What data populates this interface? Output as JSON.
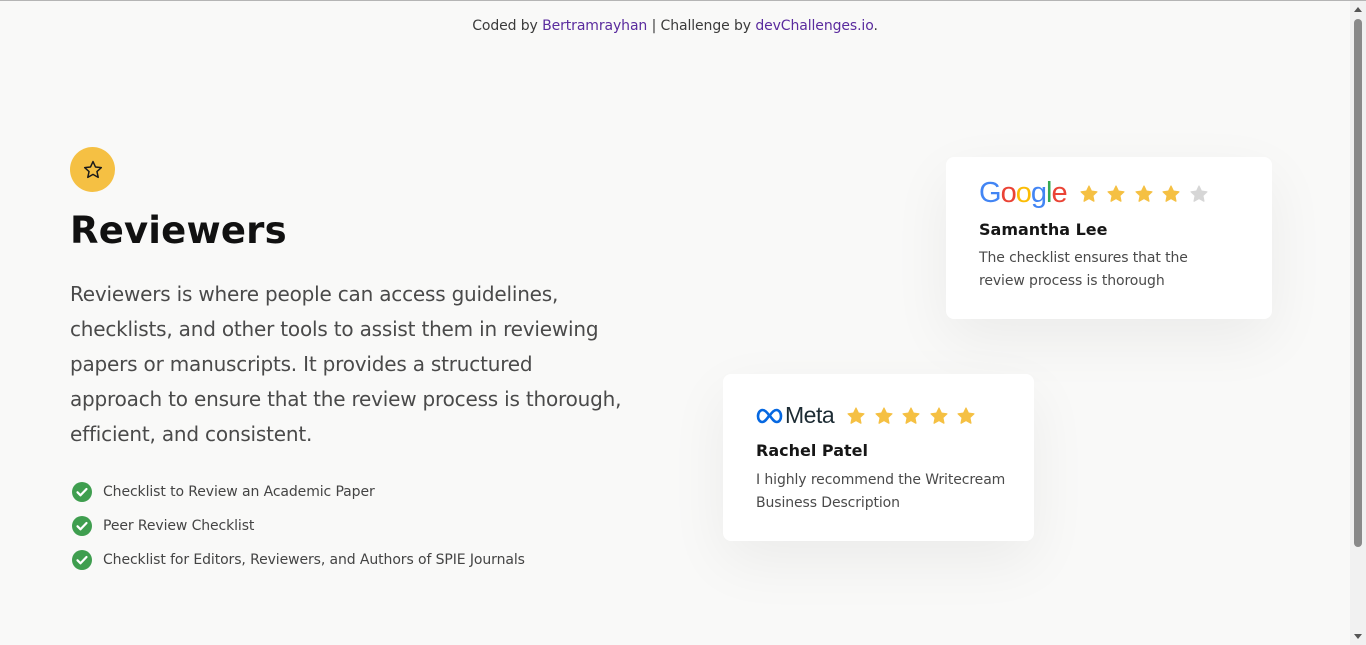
{
  "credit": {
    "prefix": "Coded by",
    "author": "Bertramrayhan",
    "separator": "| Challenge by",
    "site": "devChallenges.io",
    "suffix": "."
  },
  "hero": {
    "icon": "star-icon",
    "title": "Reviewers",
    "description": "Reviewers is where people can access guidelines, checklists, and other tools to assist them in reviewing papers or manuscripts. It provides a structured approach to ensure that the review process is thorough, efficient, and consistent.",
    "features": [
      "Checklist to Review an Academic Paper",
      "Peer Review Checklist",
      "Checklist for Editors, Reviewers, and Authors of SPIE Journals"
    ]
  },
  "reviews": [
    {
      "brand": "Google",
      "brand_letters": [
        "G",
        "o",
        "o",
        "g",
        "l",
        "e"
      ],
      "rating": 4,
      "name": "Samantha Lee",
      "quote": "The checklist ensures that the review process is thorough"
    },
    {
      "brand": "Meta",
      "rating": 5,
      "name": "Rachel Patel",
      "quote": "I highly recommend the Writecream Business Description"
    }
  ],
  "colors": {
    "accent_yellow": "#f5c043",
    "star_filled": "#f5c043",
    "star_empty": "#d6d6d6",
    "check_green": "#3f9e4f",
    "link_purple": "#5a2b9e",
    "google_blue": "#4285f4",
    "google_red": "#ea4335",
    "google_yellow": "#fbbc05",
    "google_green": "#34a853",
    "meta_blue": "#0668e1"
  }
}
